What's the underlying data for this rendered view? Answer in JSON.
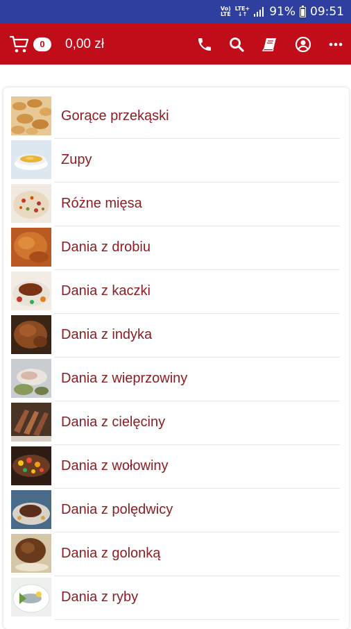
{
  "status_bar": {
    "carrier_top": "Vo)",
    "carrier_bottom": "LTE",
    "network_top": "LTE+",
    "network_bottom": "↓↑",
    "battery": "91%",
    "time": "09:51"
  },
  "toolbar": {
    "cart_count": "0",
    "cart_total": "0,00 zł",
    "actions": [
      "phone-icon",
      "search-icon",
      "menu-book-icon",
      "account-icon",
      "more-icon"
    ]
  },
  "colors": {
    "status_bar": "#2f3f9f",
    "app_bar": "#c10d1a",
    "item_text": "#8b1e24"
  },
  "categories": [
    {
      "label": "Gorące przekąski",
      "icon": "hot-snacks-thumbnail"
    },
    {
      "label": "Zupy",
      "icon": "soup-thumbnail"
    },
    {
      "label": "Różne mięsa",
      "icon": "meats-thumbnail"
    },
    {
      "label": "Dania z drobiu",
      "icon": "poultry-thumbnail"
    },
    {
      "label": "Dania z kaczki",
      "icon": "duck-thumbnail"
    },
    {
      "label": "Dania z indyka",
      "icon": "turkey-thumbnail"
    },
    {
      "label": "Dania z wieprzowiny",
      "icon": "pork-thumbnail"
    },
    {
      "label": "Dania z cielęciny",
      "icon": "veal-thumbnail"
    },
    {
      "label": "Dania z wołowiny",
      "icon": "beef-thumbnail"
    },
    {
      "label": "Dania z polędwicy",
      "icon": "tenderloin-thumbnail"
    },
    {
      "label": "Dania z golonką",
      "icon": "pork-knuckle-thumbnail"
    },
    {
      "label": "Dania z ryby",
      "icon": "fish-thumbnail"
    }
  ]
}
